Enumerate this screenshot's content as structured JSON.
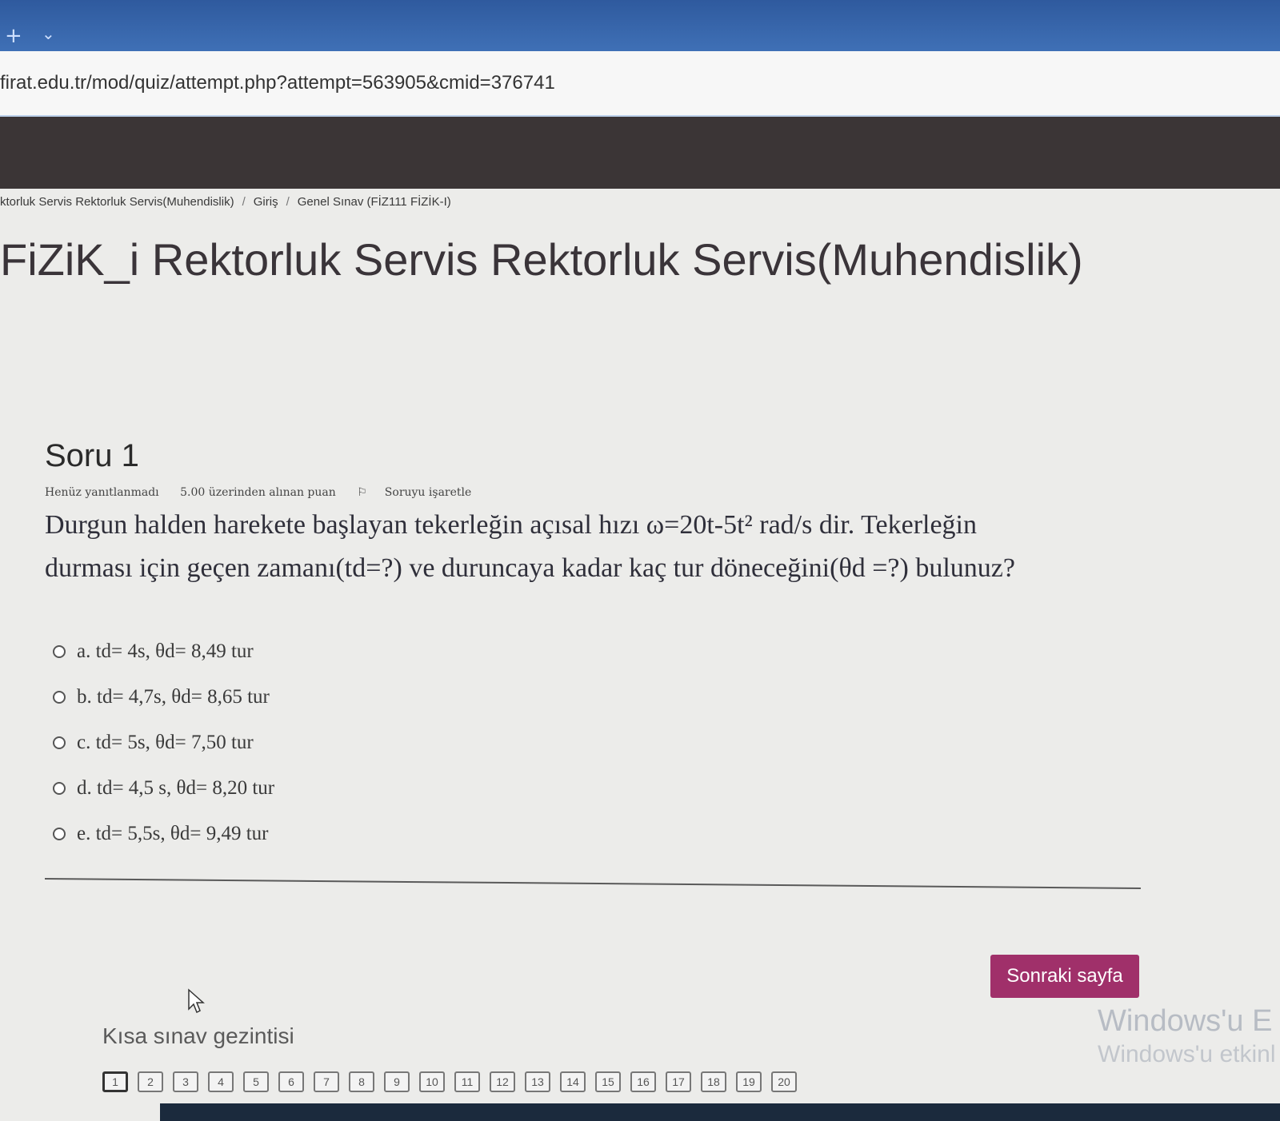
{
  "browser": {
    "url": "firat.edu.tr/mod/quiz/attempt.php?attempt=563905&cmid=376741"
  },
  "breadcrumb": [
    "ktorluk Servis Rektorluk Servis(Muhendislik)",
    "Giriş",
    "Genel Sınav (FİZ111 FİZİK-I)"
  ],
  "page_title": "FiZiK_i Rektorluk Servis Rektorluk Servis(Muhendislik)",
  "question": {
    "title": "Soru 1",
    "status": "Henüz yanıtlanmadı",
    "points": "5.00 üzerinden alınan puan",
    "flag_label": "Soruyu işaretle",
    "text_line1": "Durgun halden harekete başlayan tekerleğin açısal hızı  ω=20t-5t² rad/s dir. Tekerleğin",
    "text_line2": "durması için geçen zamanı(td=?) ve duruncaya kadar kaç tur döneceğini(θd =?) bulunuz?",
    "options": [
      {
        "label": "a. td= 4s,   θd= 8,49 tur"
      },
      {
        "label": "b. td= 4,7s,   θd= 8,65 tur"
      },
      {
        "label": "c. td= 5s,   θd= 7,50 tur"
      },
      {
        "label": "d. td= 4,5 s,   θd= 8,20 tur"
      },
      {
        "label": "e. td= 5,5s,   θd= 9,49 tur"
      }
    ]
  },
  "next_button": "Sonraki sayfa",
  "quiz_nav": {
    "title": "Kısa sınav gezintisi",
    "pages": [
      "1",
      "2",
      "3",
      "4",
      "5",
      "6",
      "7",
      "8",
      "9",
      "10",
      "11",
      "12",
      "13",
      "14",
      "15",
      "16",
      "17",
      "18",
      "19",
      "20"
    ]
  },
  "watermark": {
    "line1": "Windows'u E",
    "line2": "Windows'u etkinl"
  }
}
